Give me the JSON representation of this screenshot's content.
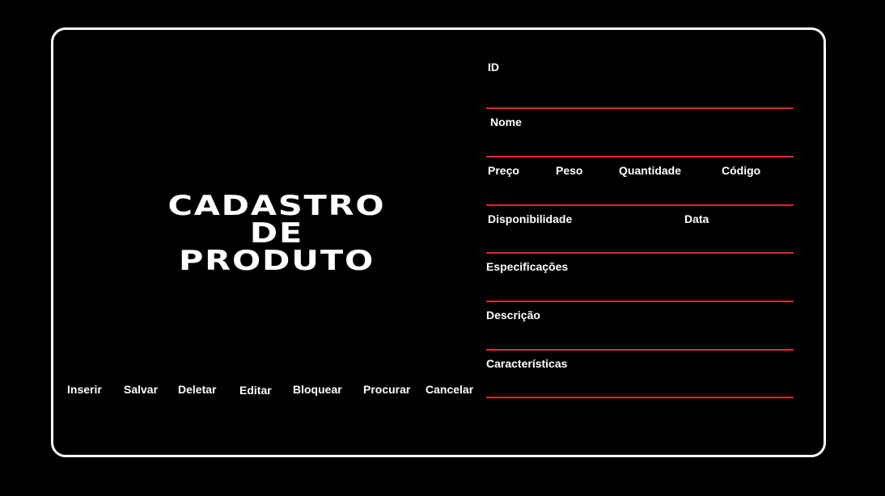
{
  "title": {
    "line1": "CADASTRO",
    "line2": "DE",
    "line3": "PRODUTO"
  },
  "buttons": {
    "inserir": "Inserir",
    "salvar": "Salvar",
    "deletar": "Deletar",
    "editar": "Editar",
    "bloquear": "Bloquear",
    "procurar": "Procurar",
    "cancelar": "Cancelar"
  },
  "fields": {
    "id": "ID",
    "nome": "Nome",
    "preco": "Preço",
    "peso": "Peso",
    "quantidade": "Quantidade",
    "codigo": "Código",
    "disponibilidade": "Disponibilidade",
    "data": "Data",
    "especificacoes": "Especificações",
    "descricao": "Descrição",
    "caracteristicas": "Características"
  },
  "colors": {
    "background": "#000000",
    "text": "#ffffff",
    "underline": "#e0282b"
  }
}
